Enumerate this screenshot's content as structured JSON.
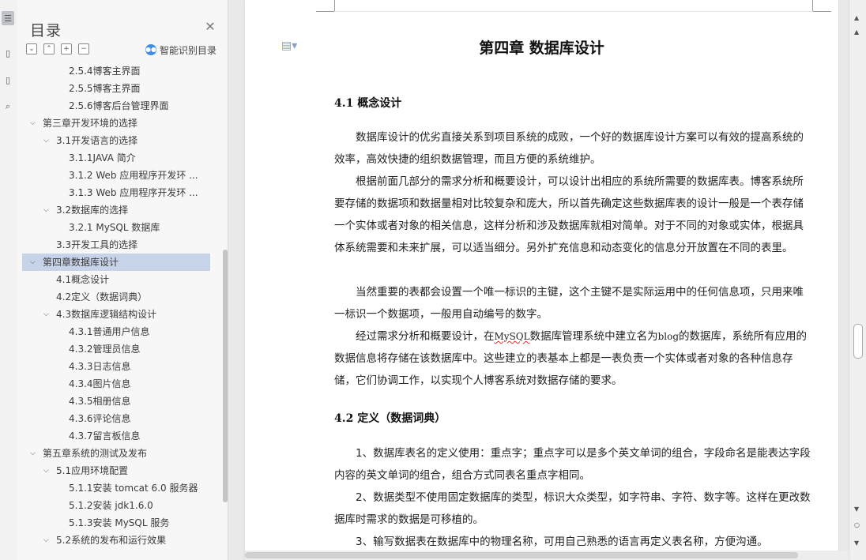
{
  "toc": {
    "title": "目录",
    "smart_label": "智能识别目录",
    "items": [
      {
        "text": "2.5.4博客主界面",
        "level": 3,
        "caret": false
      },
      {
        "text": "2.5.5博客主界面",
        "level": 3,
        "caret": false
      },
      {
        "text": "2.5.6博客后台管理界面",
        "level": 3,
        "caret": false
      },
      {
        "text": "第三章开发环境的选择",
        "level": 1,
        "caret": true
      },
      {
        "text": "3.1开发语言的选择",
        "level": 2,
        "caret": true
      },
      {
        "text": "3.1.1JAVA 简介",
        "level": 3,
        "caret": false
      },
      {
        "text": "3.1.2  Web 应用程序开发环 ...",
        "level": 3,
        "caret": false
      },
      {
        "text": "3.1.3  Web 应用程序开发环 ...",
        "level": 3,
        "caret": false
      },
      {
        "text": "3.2数据库的选择",
        "level": 2,
        "caret": true
      },
      {
        "text": "3.2.1  MySQL 数据库",
        "level": 3,
        "caret": false
      },
      {
        "text": "3.3开发工具的选择",
        "level": 2,
        "caret": false
      },
      {
        "text": "第四章数据库设计",
        "level": 1,
        "caret": true,
        "active": true
      },
      {
        "text": "4.1概念设计",
        "level": 2,
        "caret": false
      },
      {
        "text": "4.2定义（数据词典）",
        "level": 2,
        "caret": false
      },
      {
        "text": "4.3数据库逻辑结构设计",
        "level": 2,
        "caret": true
      },
      {
        "text": "4.3.1普通用户信息",
        "level": 3,
        "caret": false
      },
      {
        "text": "4.3.2管理员信息",
        "level": 3,
        "caret": false
      },
      {
        "text": "4.3.3日志信息",
        "level": 3,
        "caret": false
      },
      {
        "text": "4.3.4图片信息",
        "level": 3,
        "caret": false
      },
      {
        "text": "4.3.5相册信息",
        "level": 3,
        "caret": false
      },
      {
        "text": "4.3.6评论信息",
        "level": 3,
        "caret": false
      },
      {
        "text": "4.3.7留言板信息",
        "level": 3,
        "caret": false
      },
      {
        "text": "第五章系统的测试及发布",
        "level": 1,
        "caret": true
      },
      {
        "text": "5.1应用环境配置",
        "level": 2,
        "caret": true
      },
      {
        "text": "5.1.1安装 tomcat 6.0 服务器",
        "level": 3,
        "caret": false
      },
      {
        "text": "5.1.2安装 jdk1.6.0",
        "level": 3,
        "caret": false
      },
      {
        "text": "5.1.3安装 MySQL 服务",
        "level": 3,
        "caret": false
      },
      {
        "text": "5.2系统的发布和运行效果",
        "level": 2,
        "caret": true
      }
    ]
  },
  "doc": {
    "chapter_title": "第四章  数据库设计",
    "sec1_title": "4.1 概念设计",
    "p1": "数据库设计的优劣直接关系到项目系统的成败，一个好的数据库设计方案可以有效的提高系统的效率，高效快捷的组织数据管理，而且方便的系统维护。",
    "p2": "根据前面几部分的需求分析和概要设计，可以设计出相应的系统所需要的数据库表。博客系统所要存储的数据项和数据量相对比较复杂和庞大，所以首先确定这些数据库表的设计一般是一个表存储一个实体或者对象的相关信息，这样分析和涉及数据库就相对简单。对于不同的对象或实体，根据具体系统需要和未来扩展，可以适当细分。另外扩充信息和动态变化的信息分开放置在不同的表里。",
    "p3": "当然重要的表都会设置一个唯一标识的主键，这个主键不是实际运用中的任何信息项，只用来唯一标识一个数据项，一般用自动编号的数字。",
    "p4_a": "经过需求分析和概要设计，在",
    "p4_mysql": "MySQL",
    "p4_b": "数据库管理系统中建立名为",
    "p4_blog": "blog",
    "p4_c": "的数据库，系统所有应用的数据信息将存储在该数据库中。这些建立的表基本上都是一表负责一个实体或者对象的各种信息存储，它们协调工作，以实现个人博客系统对数据存储的要求。",
    "sec2_title": "4.2 定义（数据词典）",
    "p5": "1、数据库表名的定义使用：重点字；重点字可以是多个英文单词的组合，字段命名是能表达字段内容的英文单词的组合，组合方式同表名重点字相同。",
    "p6": "2、数据类型不使用固定数据库的类型，标识大众类型，如字符串、字符、数字等。这样在更改数据库时需求的数据是可移植的。",
    "p7": "3、输写数据表在数据库中的物理名称，可用自己熟悉的语言再定义表名称，方便沟通。"
  }
}
